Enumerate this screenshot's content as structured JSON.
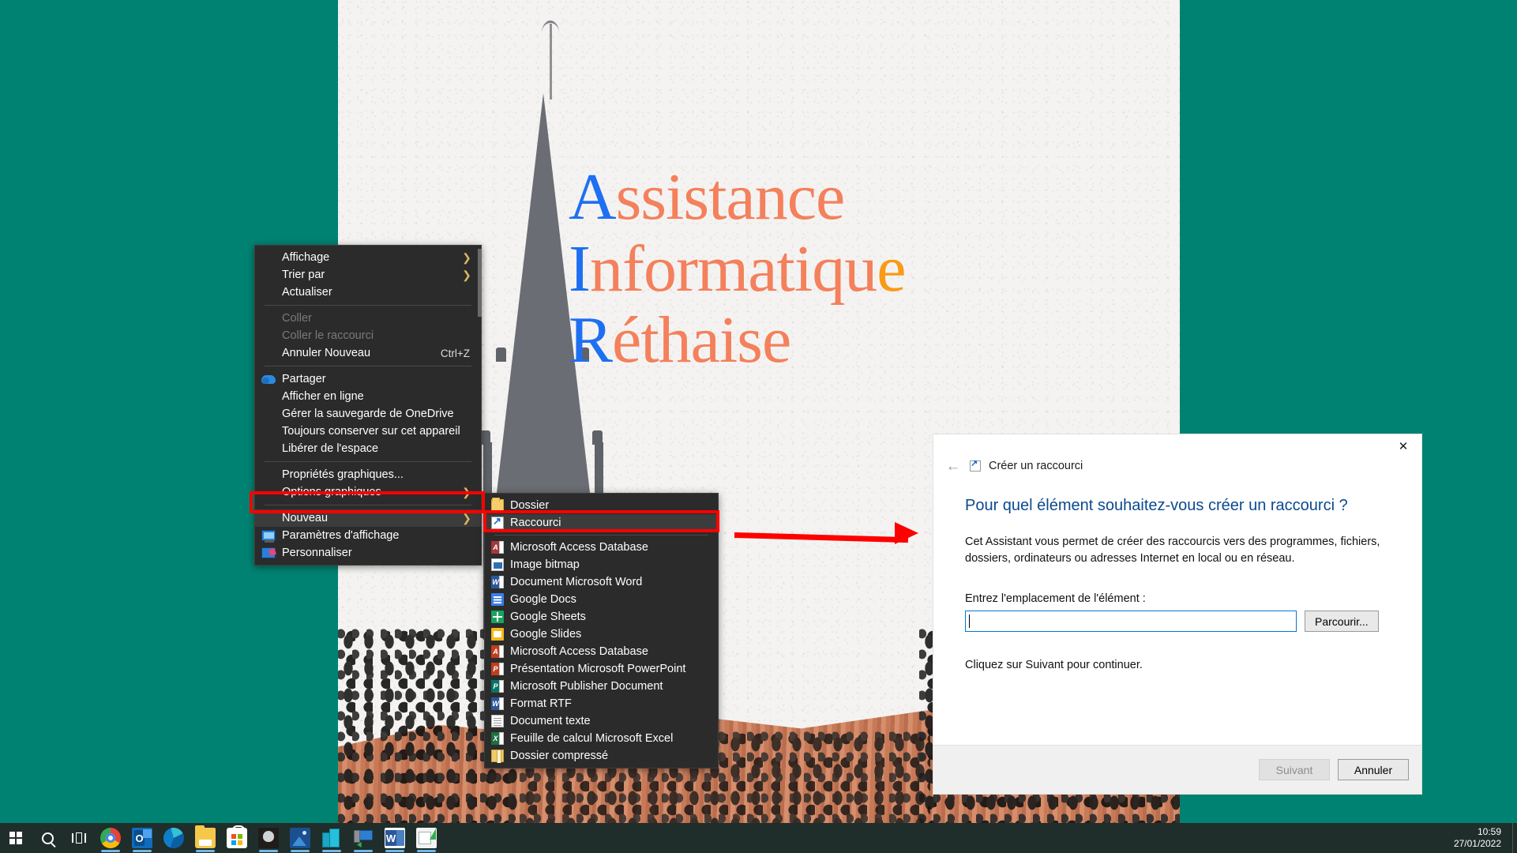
{
  "desktop": {
    "background_color": "#008272",
    "wallpaper": {
      "line1_cap": "A",
      "line1_rest": "ssistance",
      "line2_cap": "I",
      "line2_rest": "nformatiqu",
      "line2_tail": "e",
      "line3_cap": "R",
      "line3_rest": "éthaise",
      "cap_color": "#1e6ff2",
      "body_color": "#f4805c",
      "accent_color": "#fa9a16",
      "subject": "church-spire-photo"
    }
  },
  "context_menu": {
    "items": [
      {
        "label": "Affichage",
        "icon": "",
        "submenu": true,
        "disabled": false,
        "accel": "",
        "type": "item"
      },
      {
        "label": "Trier par",
        "icon": "",
        "submenu": true,
        "disabled": false,
        "accel": "",
        "type": "item"
      },
      {
        "label": "Actualiser",
        "icon": "",
        "submenu": false,
        "disabled": false,
        "accel": "",
        "type": "item"
      },
      {
        "type": "separator"
      },
      {
        "label": "Coller",
        "icon": "",
        "submenu": false,
        "disabled": true,
        "accel": "",
        "type": "item"
      },
      {
        "label": "Coller le raccourci",
        "icon": "",
        "submenu": false,
        "disabled": true,
        "accel": "",
        "type": "item"
      },
      {
        "label": "Annuler Nouveau",
        "icon": "",
        "submenu": false,
        "disabled": false,
        "accel": "Ctrl+Z",
        "type": "item"
      },
      {
        "type": "separator"
      },
      {
        "label": "Partager",
        "icon": "onedrive-cloud-icon",
        "submenu": false,
        "disabled": false,
        "accel": "",
        "type": "item"
      },
      {
        "label": "Afficher en ligne",
        "icon": "",
        "submenu": false,
        "disabled": false,
        "accel": "",
        "type": "item"
      },
      {
        "label": "Gérer la sauvegarde de OneDrive",
        "icon": "",
        "submenu": false,
        "disabled": false,
        "accel": "",
        "type": "item"
      },
      {
        "label": "Toujours conserver sur cet appareil",
        "icon": "",
        "submenu": false,
        "disabled": false,
        "accel": "",
        "type": "item"
      },
      {
        "label": "Libérer de l'espace",
        "icon": "",
        "submenu": false,
        "disabled": false,
        "accel": "",
        "type": "item"
      },
      {
        "type": "separator"
      },
      {
        "label": "Propriétés graphiques...",
        "icon": "",
        "submenu": false,
        "disabled": false,
        "accel": "",
        "type": "item"
      },
      {
        "label": "Options graphiques",
        "icon": "",
        "submenu": true,
        "disabled": false,
        "accel": "",
        "type": "item"
      },
      {
        "type": "separator"
      },
      {
        "label": "Nouveau",
        "icon": "",
        "submenu": true,
        "disabled": false,
        "accel": "",
        "type": "item",
        "highlighted": true
      },
      {
        "label": "Paramètres d'affichage",
        "icon": "monitor-icon",
        "submenu": false,
        "disabled": false,
        "accel": "",
        "type": "item"
      },
      {
        "label": "Personnaliser",
        "icon": "personalize-icon",
        "submenu": false,
        "disabled": false,
        "accel": "",
        "type": "item"
      }
    ]
  },
  "submenu": {
    "items": [
      {
        "label": "Dossier",
        "icon": "folder-icon",
        "highlighted": false
      },
      {
        "label": "Raccourci",
        "icon": "shortcut-icon",
        "highlighted": true
      },
      {
        "label": "Microsoft Access Database",
        "icon": "access-icon",
        "highlighted": false
      },
      {
        "label": "Image bitmap",
        "icon": "bitmap-icon",
        "highlighted": false
      },
      {
        "label": "Document Microsoft Word",
        "icon": "word-icon",
        "highlighted": false
      },
      {
        "label": "Google Docs",
        "icon": "google-docs-icon",
        "highlighted": false
      },
      {
        "label": "Google Sheets",
        "icon": "google-sheets-icon",
        "highlighted": false
      },
      {
        "label": "Google Slides",
        "icon": "google-slides-icon",
        "highlighted": false
      },
      {
        "label": "Microsoft Access Database",
        "icon": "access2-icon",
        "highlighted": false
      },
      {
        "label": "Présentation Microsoft PowerPoint",
        "icon": "powerpoint-icon",
        "highlighted": false
      },
      {
        "label": "Microsoft Publisher Document",
        "icon": "publisher-icon",
        "highlighted": false
      },
      {
        "label": "Format RTF",
        "icon": "rtf-icon",
        "highlighted": false
      },
      {
        "label": "Document texte",
        "icon": "text-document-icon",
        "highlighted": false
      },
      {
        "label": "Feuille de calcul Microsoft Excel",
        "icon": "excel-icon",
        "highlighted": false
      },
      {
        "label": "Dossier compressé",
        "icon": "zip-icon",
        "highlighted": false
      }
    ]
  },
  "annotations": {
    "box_color": "#fe0000",
    "arrow_color": "#fe0000",
    "highlighted_menu_item": "Nouveau",
    "highlighted_submenu_item": "Raccourci"
  },
  "dialog": {
    "title": "Créer un raccourci",
    "close_label": "✕",
    "back_label": "←",
    "heading": "Pour quel élément souhaitez-vous créer un raccourci ?",
    "paragraph": "Cet Assistant vous permet de créer des raccourcis vers des programmes, fichiers, dossiers, ordinateurs ou adresses Internet en local ou en réseau.",
    "field_label": "Entrez l'emplacement de l'élément :",
    "field_value": "",
    "field_placeholder": "",
    "browse_label": "Parcourir...",
    "note": "Cliquez sur Suivant pour continuer.",
    "next_label": "Suivant",
    "next_disabled": true,
    "cancel_label": "Annuler",
    "heading_color": "#0b4a8f"
  },
  "taskbar": {
    "background_color": "#1f2e2b",
    "start_label": "Démarrer",
    "search_label": "Rechercher",
    "taskview_label": "Affichage des tâches",
    "apps": [
      {
        "name": "Google Chrome",
        "icon": "chrome-icon",
        "running": true
      },
      {
        "name": "Microsoft Outlook",
        "icon": "outlook-icon",
        "running": true
      },
      {
        "name": "Microsoft Edge",
        "icon": "edge-icon",
        "running": false
      },
      {
        "name": "Explorateur de fichiers",
        "icon": "file-explorer-icon",
        "running": true
      },
      {
        "name": "Microsoft Store",
        "icon": "microsoft-store-icon",
        "running": false
      },
      {
        "name": "HWMonitor",
        "icon": "cat-icon",
        "running": true
      },
      {
        "name": "Photos",
        "icon": "photos-icon",
        "running": true
      },
      {
        "name": "Serveurs",
        "icon": "servers-icon",
        "running": true
      },
      {
        "name": "Bureau à distance",
        "icon": "remote-desktop-icon",
        "running": true
      },
      {
        "name": "Microsoft Word",
        "icon": "word-app-icon",
        "running": true
      },
      {
        "name": "Microsoft Publisher",
        "icon": "publisher-app-icon",
        "running": true
      }
    ],
    "clock": {
      "time": "10:59",
      "date": "27/01/2022"
    }
  }
}
